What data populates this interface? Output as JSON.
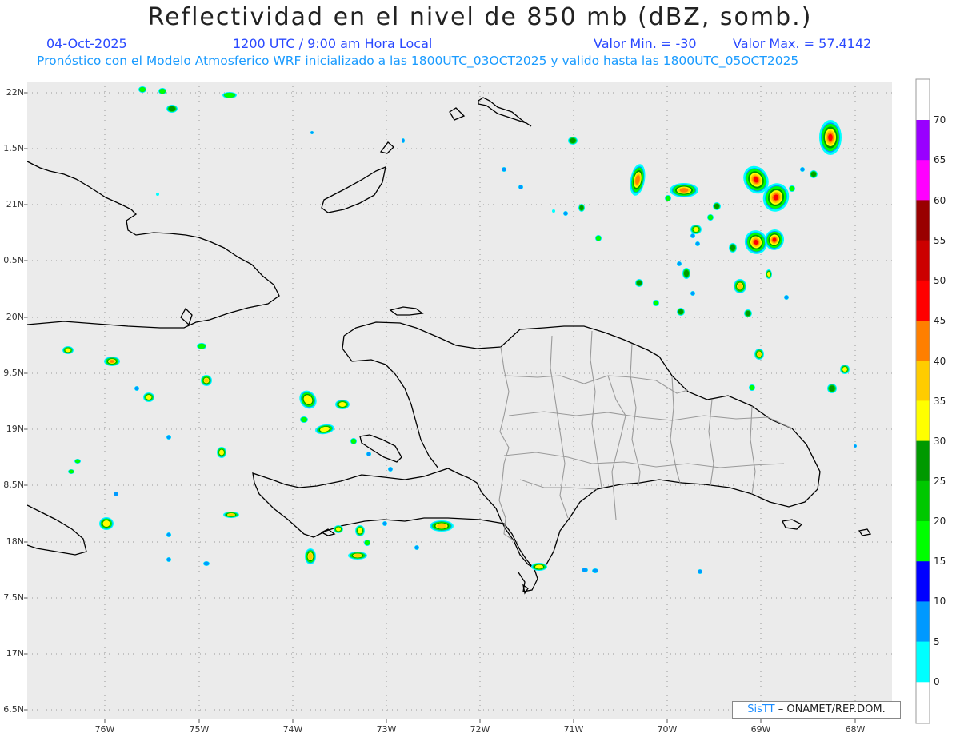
{
  "header": {
    "title": "Reflectividad en el nivel de 850 mb (dBZ, somb.)",
    "date": "04-Oct-2025",
    "time": "1200 UTC / 9:00 am Hora Local",
    "min_label": "Valor Min. = -30",
    "max_label": "Valor Max. = 57.4142",
    "description": "Pronóstico con el Modelo Atmosferico WRF inicializado a las 1800UTC_03OCT2025 y valido hasta las  1800UTC_05OCT2025"
  },
  "axes": {
    "lat_labels": [
      "22N",
      "1.5N",
      "21N",
      "0.5N",
      "20N",
      "9.5N",
      "19N",
      "8.5N",
      "18N",
      "7.5N",
      "17N",
      "6.5N"
    ],
    "lon_labels": [
      "76W",
      "75W",
      "74W",
      "73W",
      "72W",
      "71W",
      "70W",
      "69W",
      "68W"
    ]
  },
  "colorbar": {
    "labels": [
      "70",
      "65",
      "60",
      "55",
      "50",
      "45",
      "40",
      "35",
      "30",
      "25",
      "20",
      "15",
      "10",
      "5",
      "0"
    ],
    "colors": [
      "#9900ff",
      "#ff00ff",
      "#990000",
      "#cc0000",
      "#ff0000",
      "#ff7f00",
      "#ffcc00",
      "#ffff00",
      "#009900",
      "#00c800",
      "#00ff00",
      "#0000ff",
      "#0099ff",
      "#00ffff"
    ]
  },
  "credit": {
    "brand": "SisTT",
    "text": "– ONAMET/REP.DOM."
  },
  "map": {
    "background": "#ebebeb",
    "coast_color": "#000000",
    "province_color": "#9a9a9a"
  }
}
